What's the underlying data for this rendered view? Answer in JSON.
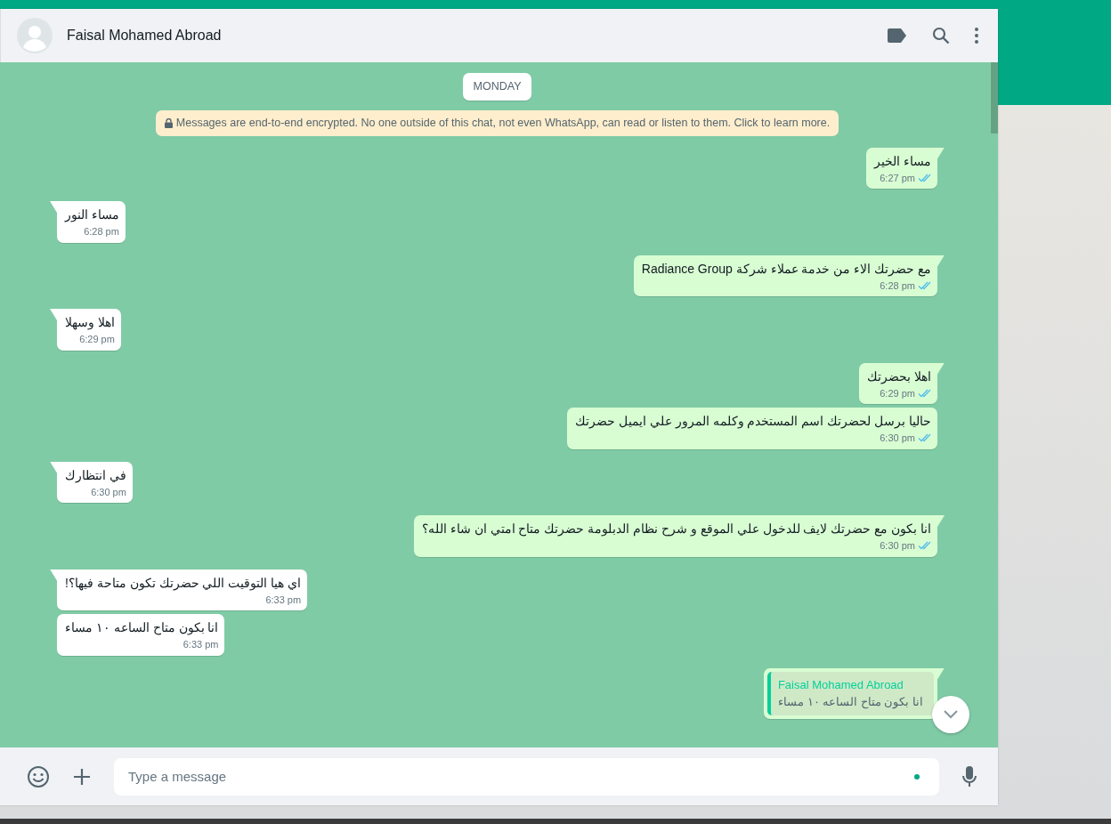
{
  "chat": {
    "contact_name": "Faisal Mohamed Abroad"
  },
  "day_label": "MONDAY",
  "encryption_notice": "Messages are end-to-end encrypted. No one outside of this chat, not even WhatsApp, can read or listen to them. Click to learn more.",
  "messages": [
    {
      "kind": "text",
      "outgoing": true,
      "tail": true,
      "text": "مساء الخير",
      "time": "6:27 pm",
      "read": true
    },
    {
      "kind": "text",
      "outgoing": false,
      "tail": true,
      "text": "مساء النور",
      "time": "6:28 pm"
    },
    {
      "kind": "text",
      "outgoing": true,
      "tail": true,
      "text": "مع حضرتك الاء من خدمة عملاء شركة Radiance Group",
      "time": "6:28 pm",
      "read": true
    },
    {
      "kind": "text",
      "outgoing": false,
      "tail": true,
      "text": "اهلا وسهلا",
      "time": "6:29 pm"
    },
    {
      "kind": "text",
      "outgoing": true,
      "tail": true,
      "text": "اهلا بحضرتك",
      "time": "6:29 pm",
      "read": true
    },
    {
      "kind": "text",
      "outgoing": true,
      "tail": false,
      "text": "حاليا برسل لحضرتك اسم المستخدم وكلمه المرور علي ايميل حضرتك",
      "time": "6:30 pm",
      "read": true
    },
    {
      "kind": "text",
      "outgoing": false,
      "tail": true,
      "text": "في انتظارك",
      "time": "6:30 pm"
    },
    {
      "kind": "text",
      "outgoing": true,
      "tail": true,
      "text": "انا بكون مع حضرتك لايف للدخول علي الموقع و شرح نظام الدبلومة حضرتك متاح امتي ان شاء الله؟",
      "time": "6:30 pm",
      "read": true
    },
    {
      "kind": "text",
      "outgoing": false,
      "tail": true,
      "text": "اي هيا التوقيت اللي حضرتك تكون متاحة فيها؟!",
      "time": "6:33 pm"
    },
    {
      "kind": "text",
      "outgoing": false,
      "tail": false,
      "text": "انا بكون متاح الساعه ١٠ مساء",
      "time": "6:33 pm"
    },
    {
      "kind": "quote",
      "outgoing": true,
      "tail": true,
      "quote_author": "Faisal Mohamed Abroad",
      "quote_text": "انا بكون متاح الساعه ١٠ مساء"
    }
  ],
  "composer": {
    "placeholder": "Type a message"
  }
}
